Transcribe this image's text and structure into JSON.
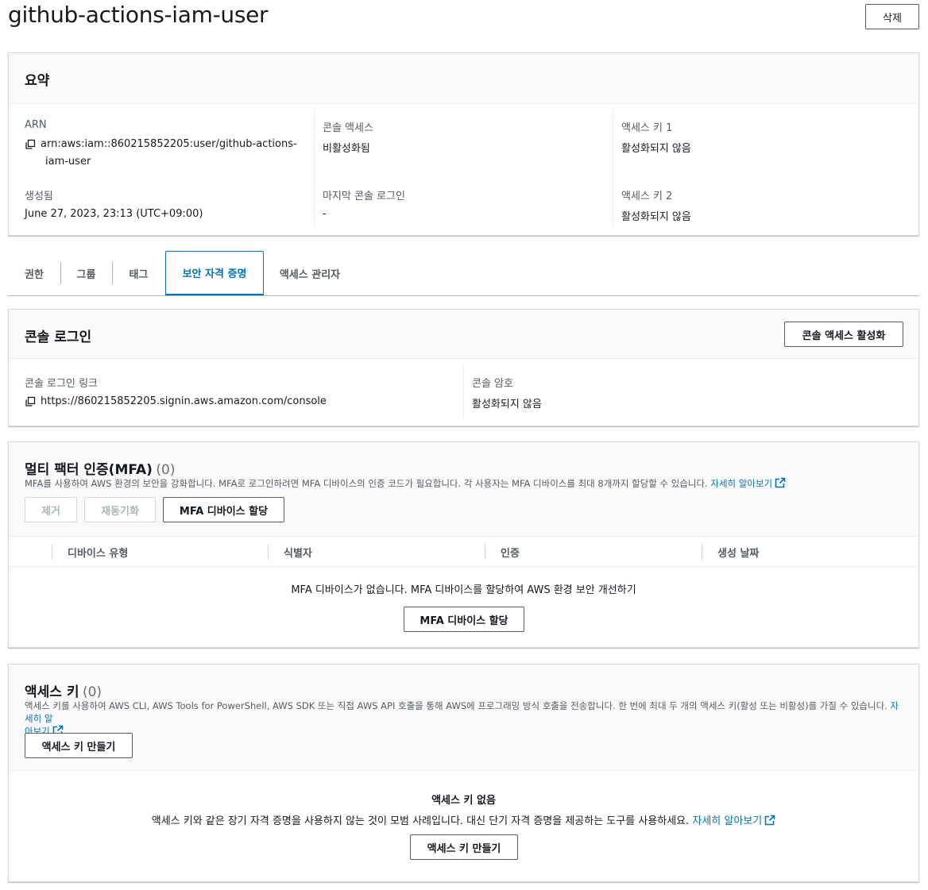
{
  "header": {
    "title": "github-actions-iam-user",
    "delete_label": "삭제"
  },
  "summary": {
    "title": "요약",
    "arn_label": "ARN",
    "arn_value_line1": "arn:aws:iam::860215852205:user/github-actions-",
    "arn_value_line2": "iam-user",
    "created_label": "생성됨",
    "created_value": "June 27, 2023, 23:13 (UTC+09:00)",
    "console_access_label": "콘솔 액세스",
    "console_access_value": "비활성화됨",
    "last_login_label": "마지막 콘솔 로그인",
    "last_login_value": "-",
    "key1_label": "액세스 키 1",
    "key1_value": "활성화되지 않음",
    "key2_label": "액세스 키 2",
    "key2_value": "활성화되지 않음"
  },
  "tabs": [
    {
      "label": "권한"
    },
    {
      "label": "그룹"
    },
    {
      "label": "태그"
    },
    {
      "label": "보안 자격 증명",
      "active": true
    },
    {
      "label": "액세스 관리자"
    }
  ],
  "console_login": {
    "title": "콘솔 로그인",
    "enable_button": "콘솔 액세스 활성화",
    "link_label": "콘솔 로그인 링크",
    "link_value": "https://860215852205.signin.aws.amazon.com/console",
    "password_label": "콘솔 암호",
    "password_value": "활성화되지 않음"
  },
  "mfa": {
    "title": "멀티 팩터 인증(MFA)",
    "count": "(0)",
    "description": "MFA를 사용하여 AWS 환경의 보안을 강화합니다. MFA로 로그인하려면 MFA 디바이스의 인증 코드가 필요합니다. 각 사용자는 MFA 디바이스를 최대 8개까지 할당할 수 있습니다.",
    "learn_more": "자세히 알아보기",
    "remove_button": "제거",
    "resync_button": "재동기화",
    "assign_button": "MFA 디바이스 할당",
    "columns": [
      "디바이스 유형",
      "식별자",
      "인증",
      "생성 날짜"
    ],
    "empty_text": "MFA 디바이스가 없습니다. MFA 디바이스를 할당하여 AWS 환경 보안 개선하기",
    "empty_assign_button": "MFA 디바이스 할당"
  },
  "access_keys": {
    "title": "액세스 키",
    "count": "(0)",
    "description": "액세스 키를 사용하여 AWS CLI, AWS Tools for PowerShell, AWS SDK 또는 직접 AWS API 호출을 통해 AWS에 프로그래밍 방식 호출을 전송합니다. 한 번에 최대 두 개의 액세스 키(활성 또는 비활성)를 가질 수 있습니다.",
    "learn_more_part1": "자세히 알",
    "learn_more_part2": "아보기",
    "create_button": "액세스 키 만들기",
    "empty_title": "액세스 키 없음",
    "empty_text": "액세스 키와 같은 장기 자격 증명을 사용하지 않는 것이 모범 사례입니다. 대신 단기 자격 증명을 제공하는 도구를 사용하세요.",
    "empty_learn_more": "자세히 알아보기",
    "empty_create_button": "액세스 키 만들기"
  },
  "colors": {
    "link": "#0073bb",
    "text": "#16191f",
    "muted": "#545b64",
    "border": "#d5dbdb"
  }
}
